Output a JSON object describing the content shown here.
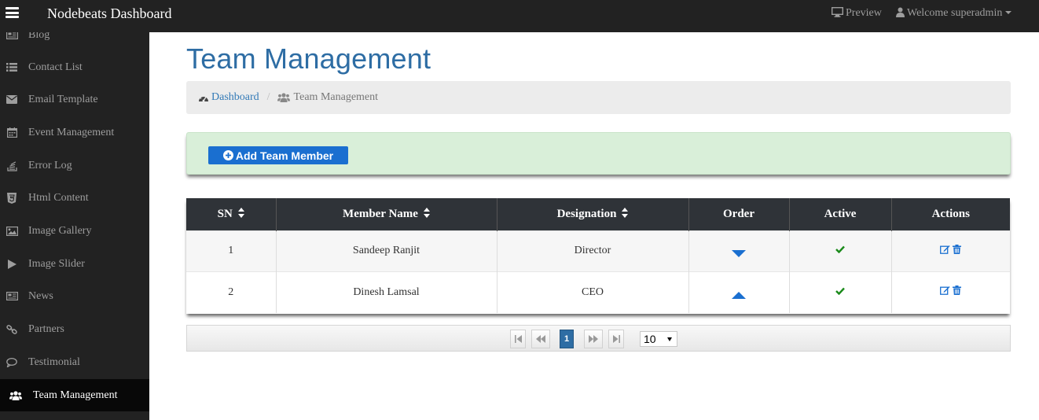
{
  "header": {
    "brand": "Nodebeats Dashboard",
    "preview_label": "Preview",
    "welcome_label": "Welcome superadmin"
  },
  "sidebar": {
    "items": [
      {
        "label": "Blog",
        "icon": "newspaper-icon"
      },
      {
        "label": "Contact List",
        "icon": "list-icon"
      },
      {
        "label": "Email Template",
        "icon": "envelope-icon"
      },
      {
        "label": "Event Management",
        "icon": "calendar-icon"
      },
      {
        "label": "Error Log",
        "icon": "stack-icon"
      },
      {
        "label": "Html Content",
        "icon": "html5-icon"
      },
      {
        "label": "Image Gallery",
        "icon": "image-icon"
      },
      {
        "label": "Image Slider",
        "icon": "play-icon"
      },
      {
        "label": "News",
        "icon": "newspaper-icon"
      },
      {
        "label": "Partners",
        "icon": "link-icon"
      },
      {
        "label": "Testimonial",
        "icon": "comment-icon"
      },
      {
        "label": "Team Management",
        "icon": "users-icon",
        "active": true
      }
    ]
  },
  "main": {
    "title": "Team Management",
    "breadcrumb": {
      "home": "Dashboard",
      "current": "Team Management"
    },
    "add_button": "Add Team Member",
    "table": {
      "columns": [
        "SN",
        "Member Name",
        "Designation",
        "Order",
        "Active",
        "Actions"
      ],
      "rows": [
        {
          "sn": "1",
          "name": "Sandeep Ranjit",
          "designation": "Director",
          "order": "down",
          "active": true
        },
        {
          "sn": "2",
          "name": "Dinesh Lamsal",
          "designation": "CEO",
          "order": "up",
          "active": true
        }
      ]
    },
    "pager": {
      "current_page": "1",
      "page_size": "10"
    }
  },
  "colors": {
    "topbar": "#222222",
    "accent": "#337ab7",
    "title": "#2e6da4",
    "add_button": "#1a6fd0",
    "success_panel": "#d9efd9",
    "check": "#1a8a1a"
  }
}
